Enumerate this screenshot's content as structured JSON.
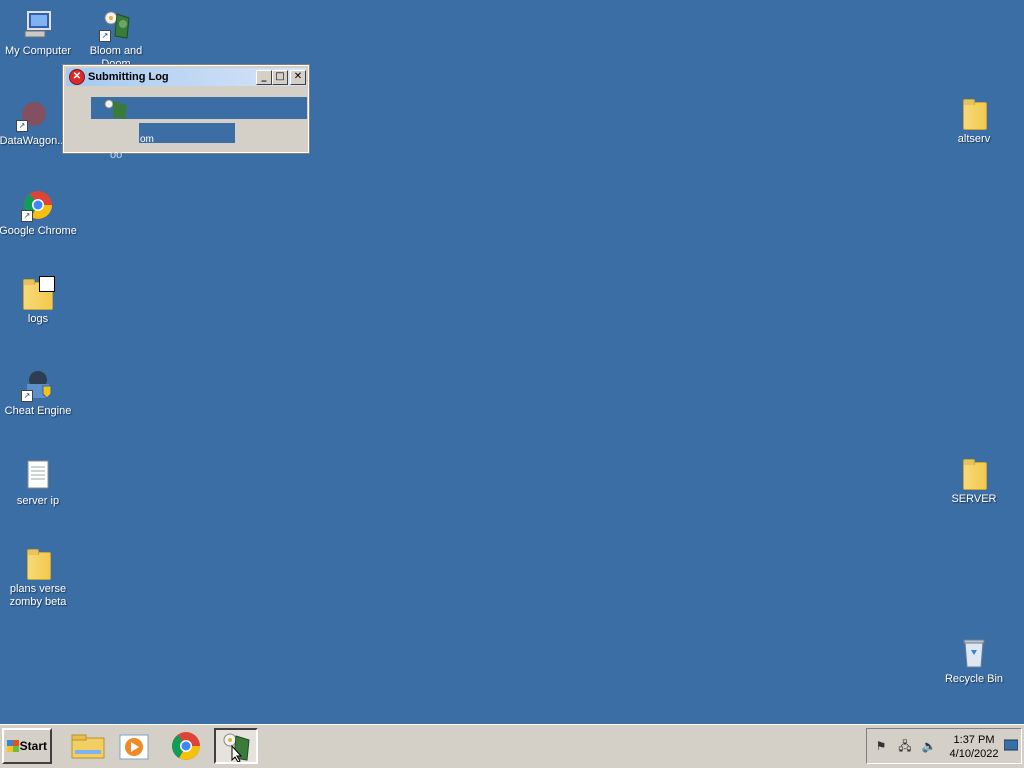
{
  "desktop": {
    "background": "#3b6ea5",
    "icons": {
      "my_computer": "My Computer",
      "bloom_doom": "Bloom and Doom",
      "datawagon": "DataWagon...",
      "google_chrome": "Google Chrome",
      "logs": "logs",
      "cheat_engine": "Cheat Engine",
      "server_ip": "server ip",
      "plans_verse": "plans verse zomby beta",
      "altserv": "altserv",
      "server": "SERVER",
      "recycle_bin": "Recycle Bin"
    }
  },
  "window": {
    "title": "Submitting Log",
    "bar_text": "om",
    "bleed_text": "oo",
    "minimize": "_",
    "maximize": "□",
    "close": "✕"
  },
  "taskbar": {
    "start_label": "Start",
    "clock_time": "1:37 PM",
    "clock_date": "4/10/2022"
  }
}
